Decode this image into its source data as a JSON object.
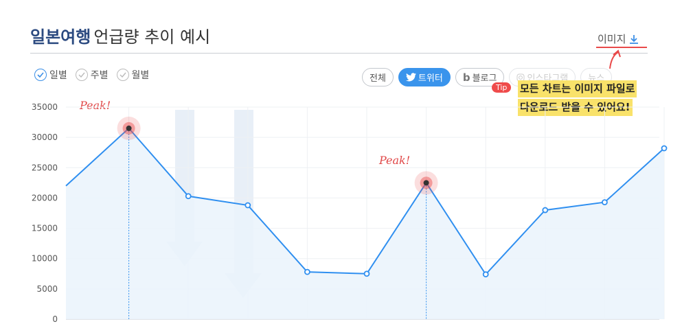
{
  "header": {
    "title_strong": "일본여행",
    "title_rest": "언급량 추이 예시",
    "download_label": "이미지"
  },
  "period_tabs": [
    {
      "label": "일별",
      "active": true
    },
    {
      "label": "주별",
      "active": false
    },
    {
      "label": "월별",
      "active": false
    }
  ],
  "source_tabs": [
    {
      "label": "전체",
      "active": false
    },
    {
      "label": "트위터",
      "active": true
    },
    {
      "label": "블로그",
      "active": false
    },
    {
      "label": "인스타그램",
      "active": false
    },
    {
      "label": "뉴스",
      "active": false
    }
  ],
  "tip": {
    "badge": "Tip",
    "line1": "모든 차트는 이미지 파일로",
    "line2": "다운로드 받을 수 있어요!"
  },
  "annotations": {
    "peak1": "Peak!",
    "peak2": "Peak!"
  },
  "colors": {
    "line": "#2f8ff0",
    "area": "#eaf3fc",
    "peak": "#e94a4a",
    "accent": "#3a94ec",
    "title": "#2b4a80"
  },
  "chart_data": {
    "type": "area",
    "x": [
      0,
      1,
      2,
      3,
      4,
      5,
      6,
      7,
      8,
      9,
      10
    ],
    "values": [
      22000,
      31500,
      20300,
      18800,
      7800,
      7500,
      22500,
      7400,
      18000,
      19300,
      28200
    ],
    "peaks": [
      1,
      6
    ],
    "ylim": [
      0,
      35000
    ],
    "yticks": [
      "35000",
      "30000",
      "25000",
      "20000",
      "15000",
      "10000",
      "5000",
      "0"
    ],
    "grid": true
  }
}
